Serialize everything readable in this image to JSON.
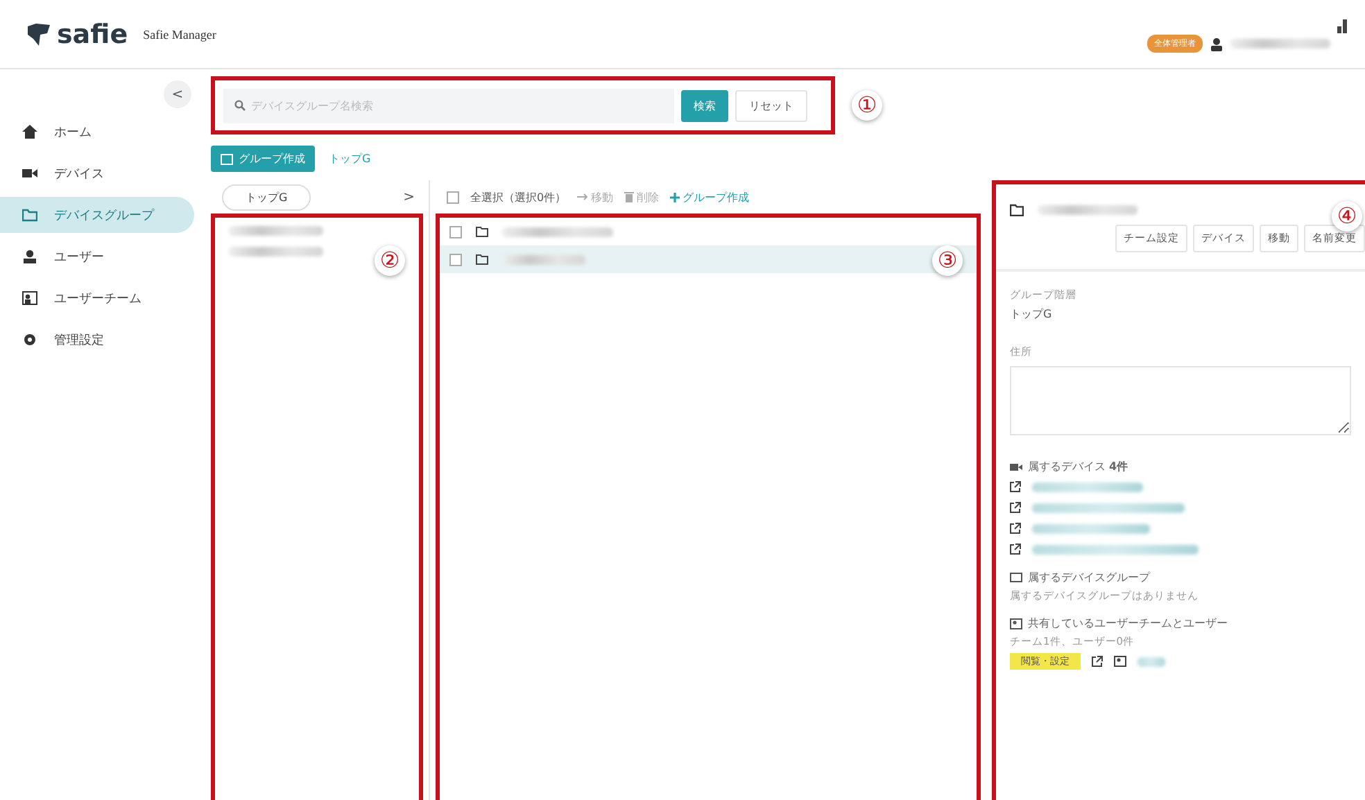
{
  "header": {
    "logo": "safie",
    "app_name": "Safie Manager",
    "role_badge": "全体管理者"
  },
  "sidebar": {
    "collapse": "<",
    "items": [
      {
        "label": "ホーム",
        "selected": false
      },
      {
        "label": "デバイス",
        "selected": false
      },
      {
        "label": "デバイスグループ",
        "selected": true
      },
      {
        "label": "ユーザー",
        "selected": false
      },
      {
        "label": "ユーザーチーム",
        "selected": false
      },
      {
        "label": "管理設定",
        "selected": false
      }
    ]
  },
  "search": {
    "placeholder": "デバイスグループ名検索",
    "search_button": "検索",
    "reset_button": "リセット",
    "annotation": "①"
  },
  "actions": {
    "create_button": "グループ作成",
    "breadcrumb": "トップG"
  },
  "tree": {
    "root": "トップG",
    "expand": ">",
    "items": [
      {
        "kind": "redacted"
      },
      {
        "kind": "redacted"
      }
    ],
    "annotation": "②"
  },
  "list": {
    "select_all_checked": false,
    "select_all": "全選択（選択0件）",
    "move": "移動",
    "delete": "削除",
    "create": "グループ作成",
    "annotation": "③",
    "rows": [
      {
        "checked": false,
        "selected": false
      },
      {
        "checked": false,
        "selected": true
      }
    ]
  },
  "detail": {
    "annotation": "④",
    "buttons": [
      "チーム設定",
      "デバイス",
      "移動",
      "名前変更"
    ],
    "hierarchy_label": "グループ階層",
    "hierarchy_value": "トップG",
    "address_label": "住所",
    "devices_heading": "属するデバイス **4件**",
    "devices": [
      {
        "kind": "redacted"
      },
      {
        "kind": "redacted"
      },
      {
        "kind": "redacted"
      },
      {
        "kind": "redacted"
      }
    ],
    "groups_heading": "属するデバイスグループ",
    "groups_empty": "属するデバイスグループはありません",
    "share_heading": "共有しているユーザーチームとユーザー",
    "share_count": "チーム1件、ユーザー0件",
    "permission_badge": "閲覧・設定"
  }
}
